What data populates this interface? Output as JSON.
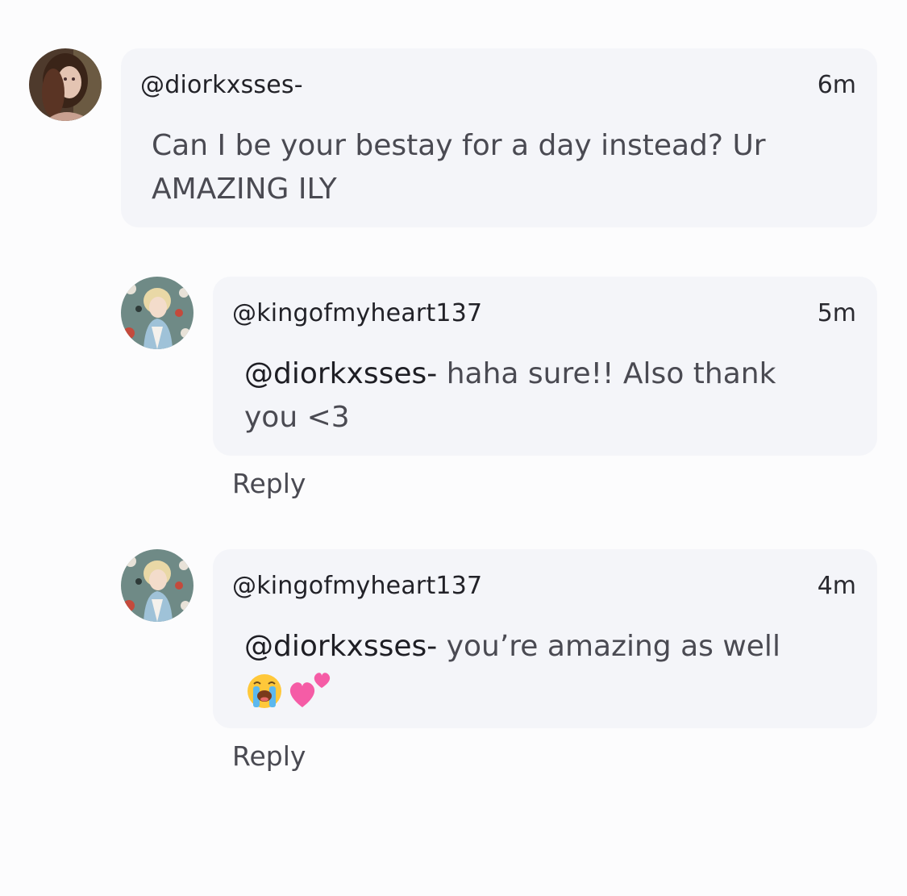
{
  "comments": [
    {
      "username": "@diorkxsses-",
      "time": "6m",
      "text": "Can I be your bestay for a day instead? Ur AMAZING ILY",
      "avatar_icon": "profile-photo-woman"
    },
    {
      "username": "@kingofmyheart137",
      "time": "5m",
      "mention": "@diorkxsses-",
      "text": " haha sure!! Also thank you <3",
      "reply_label": "Reply",
      "avatar_icon": "profile-photo-cartoon"
    },
    {
      "username": "@kingofmyheart137",
      "time": "4m",
      "mention": "@diorkxsses-",
      "text": " you’re amazing as well",
      "emojis": [
        "loudly-crying-face-emoji",
        "two-hearts-emoji"
      ],
      "reply_label": "Reply",
      "avatar_icon": "profile-photo-cartoon"
    }
  ],
  "colors": {
    "background": "#fcfcfd",
    "bubble": "#f4f5f9",
    "username": "#222228",
    "body_text": "#4a4a52"
  }
}
